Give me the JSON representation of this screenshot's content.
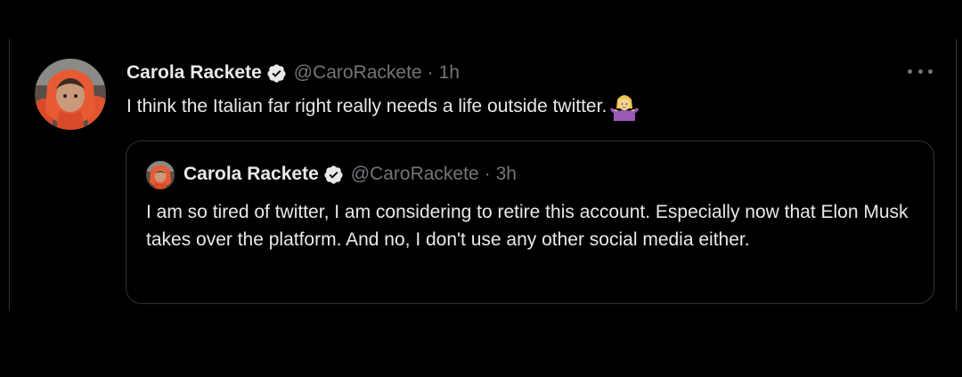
{
  "tweet": {
    "author": {
      "name": "Carola Rackete",
      "handle": "@CaroRackete",
      "verified": true
    },
    "separator": "·",
    "time": "1h",
    "text": "I think the Italian far right really needs a life outside twitter.",
    "emoji": "person-shrugging-emoji",
    "menu_icon": "more-horizontal-icon",
    "quoted": {
      "author": {
        "name": "Carola Rackete",
        "handle": "@CaroRackete",
        "verified": true
      },
      "separator": "·",
      "time": "3h",
      "text": "I am so tired of twitter, I am considering to retire this account. Especially now that Elon Musk takes over the platform. And no, I don't use any other social media either."
    }
  },
  "colors": {
    "background": "#000000",
    "text_primary": "#e7e9ea",
    "text_secondary": "#71767b",
    "border": "#2f3336",
    "verified_badge": "#e7e9ea"
  }
}
